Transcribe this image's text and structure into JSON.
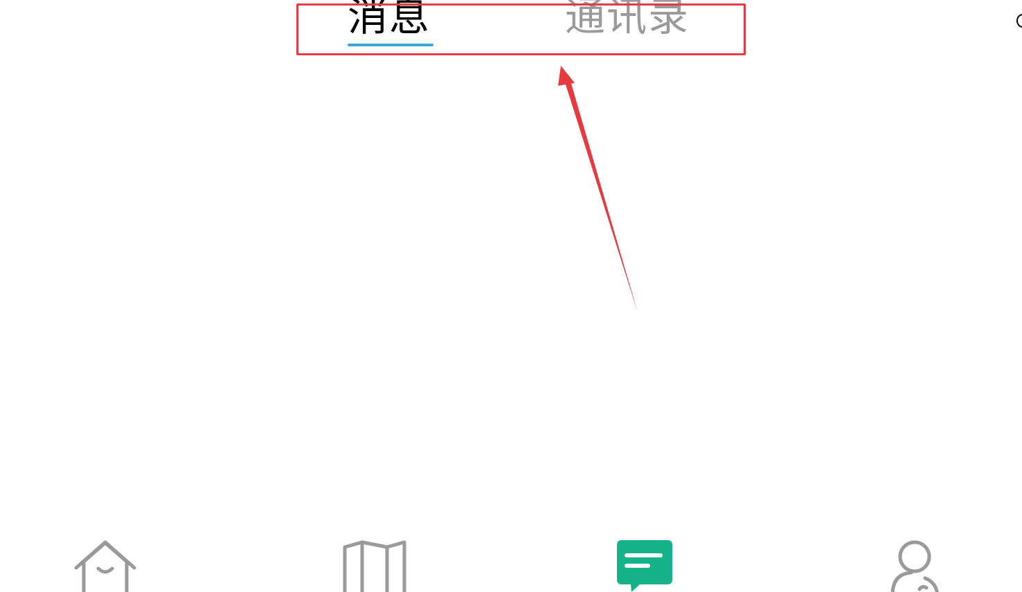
{
  "tabs": {
    "messages": {
      "label": "消息",
      "active": true
    },
    "contacts": {
      "label": "通讯录",
      "active": false
    }
  },
  "bottom_nav": {
    "items": [
      {
        "icon": "home-icon",
        "active": false
      },
      {
        "icon": "map-icon",
        "active": false
      },
      {
        "icon": "message-icon",
        "active": true
      },
      {
        "icon": "profile-icon",
        "active": false
      }
    ]
  },
  "colors": {
    "active_tab_text": "#000000",
    "inactive_tab_text": "#9a9a9a",
    "tab_indicator": "#3aa6d8",
    "nav_inactive": "#9a9a9a",
    "nav_active": "#16b38a",
    "annotation": "#e53a3f"
  }
}
